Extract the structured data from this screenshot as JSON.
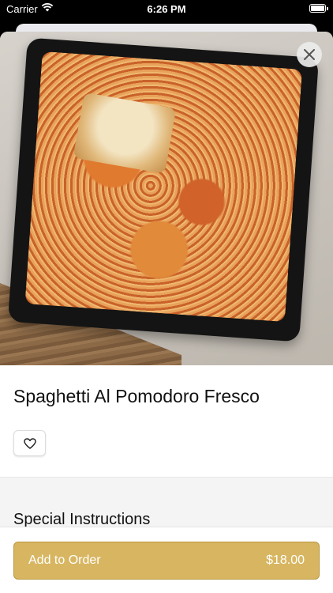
{
  "status_bar": {
    "carrier": "Carrier",
    "time": "6:26 PM"
  },
  "item": {
    "name": "Spaghetti Al Pomodoro Fresco",
    "image_icon": "pasta-photo"
  },
  "sections": {
    "special_instructions": "Special Instructions"
  },
  "order": {
    "add_label": "Add to Order",
    "price": "$18.00"
  },
  "colors": {
    "accent": "#d8b661",
    "accent_border": "#b8963e"
  }
}
